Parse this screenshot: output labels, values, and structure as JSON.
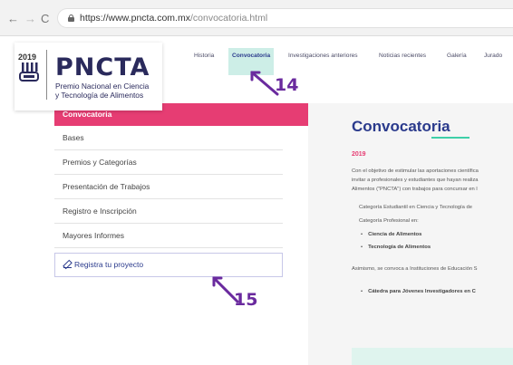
{
  "browser": {
    "url_host": "https://www.pncta.com.mx",
    "url_path": "/convocatoria.html"
  },
  "topnav": [
    {
      "label": "Historia"
    },
    {
      "label": "Convocatoria",
      "active": true
    },
    {
      "label": "Investigaciones anteriores"
    },
    {
      "label": "Noticias recientes"
    },
    {
      "label": "Galería"
    },
    {
      "label": "Jurado"
    }
  ],
  "logo": {
    "year": "2019",
    "title": "PNCTA",
    "subtitle_line1": "Premio Nacional en Ciencia",
    "subtitle_line2": "y Tecnología de Alimentos"
  },
  "sidebar": {
    "active": "Convocatoria",
    "items": [
      {
        "label": "Bases"
      },
      {
        "label": "Premios y Categorías"
      },
      {
        "label": "Presentación de Trabajos"
      },
      {
        "label": "Registro e Inscripción"
      },
      {
        "label": "Mayores Informes"
      }
    ],
    "register_label": "Registra tu proyecto"
  },
  "content": {
    "title": "Convocatoria",
    "year": "2019",
    "para_lines": [
      "Con el objetivo de estimular las aportaciones científica",
      "invitar a profesionales y estudiantes que hayan realiza",
      "Alimentos (\"PNCTA\") con trabajos para concursar en l"
    ],
    "category_lines": [
      "Categoría Estudiantil en Ciencia y Tecnología de",
      "Categoría Profesional en:"
    ],
    "bullets_a": [
      "Ciencia de Alimentos",
      "Tecnología de Alimentos"
    ],
    "asimismo": "Asimismo, se convoca a Instituciones de Educación S",
    "bullets_b": [
      "Cátedra para Jóvenes Investigadores en C"
    ]
  },
  "annotations": {
    "label_a": "14",
    "label_b": "15",
    "color": "#6a2a9e"
  },
  "colors": {
    "accent_pink": "#e63d73",
    "brand_navy": "#2a3a8c",
    "accent_teal": "#3ecfa8",
    "active_tab_bg": "#cdeee7"
  }
}
